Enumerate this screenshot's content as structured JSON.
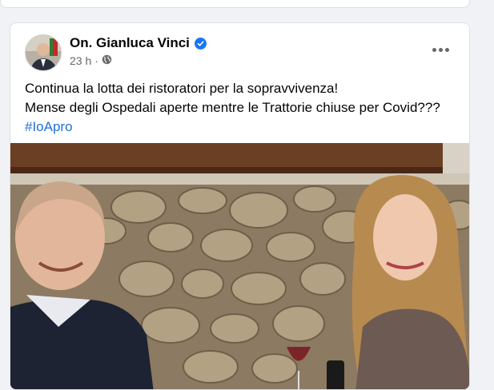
{
  "post": {
    "author": "On. Gianluca Vinci",
    "timestamp": "23 h",
    "separator": "·",
    "privacy_icon": "globe-icon",
    "more_icon": "more-horizontal-icon",
    "text_lines": [
      "Continua la lotta dei ristoratori per la sopravvivenza!",
      "Mense degli Ospedali aperte mentre le Trattorie chiuse per Covid???"
    ],
    "hashtag": "#IoApro",
    "verified_icon": "verified-badge-icon"
  },
  "colors": {
    "accent": "#1877f2",
    "hashtag": "#216fdb",
    "secondary_text": "#65676b",
    "background": "#f0f2f5"
  }
}
